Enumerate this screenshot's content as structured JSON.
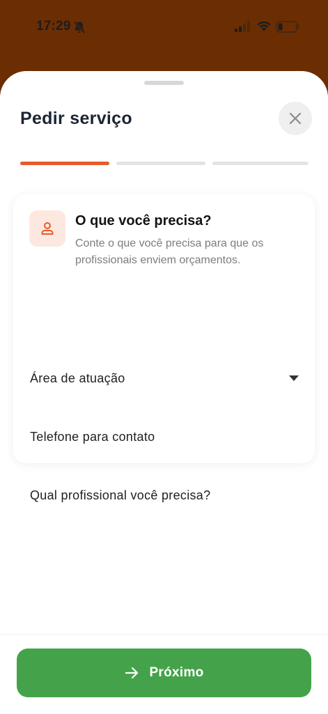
{
  "status_bar": {
    "time": "17:29",
    "icons": [
      "bell-slash-icon",
      "signal-icon",
      "wifi-icon",
      "battery-low-icon"
    ]
  },
  "colors": {
    "background": "#6b2e02",
    "accent": "#e85a2c",
    "primary_button": "#44a34a",
    "title": "#1c2434"
  },
  "sheet": {
    "title": "Pedir serviço",
    "close_icon": "close-icon",
    "progress": {
      "total_steps": 3,
      "current_step": 1
    }
  },
  "card": {
    "icon": "user-icon",
    "title": "O que você precisa?",
    "subtitle": "Conte o que você precisa para que os profissionais enviem orçamentos.",
    "fields": [
      {
        "label": "Área de atuação",
        "type": "select"
      },
      {
        "label": "Telefone para contato",
        "type": "input"
      },
      {
        "label": "Qual profissional você precisa?",
        "type": "input"
      }
    ]
  },
  "footer": {
    "next_label": "Próximo",
    "next_icon": "arrow-right-icon"
  }
}
